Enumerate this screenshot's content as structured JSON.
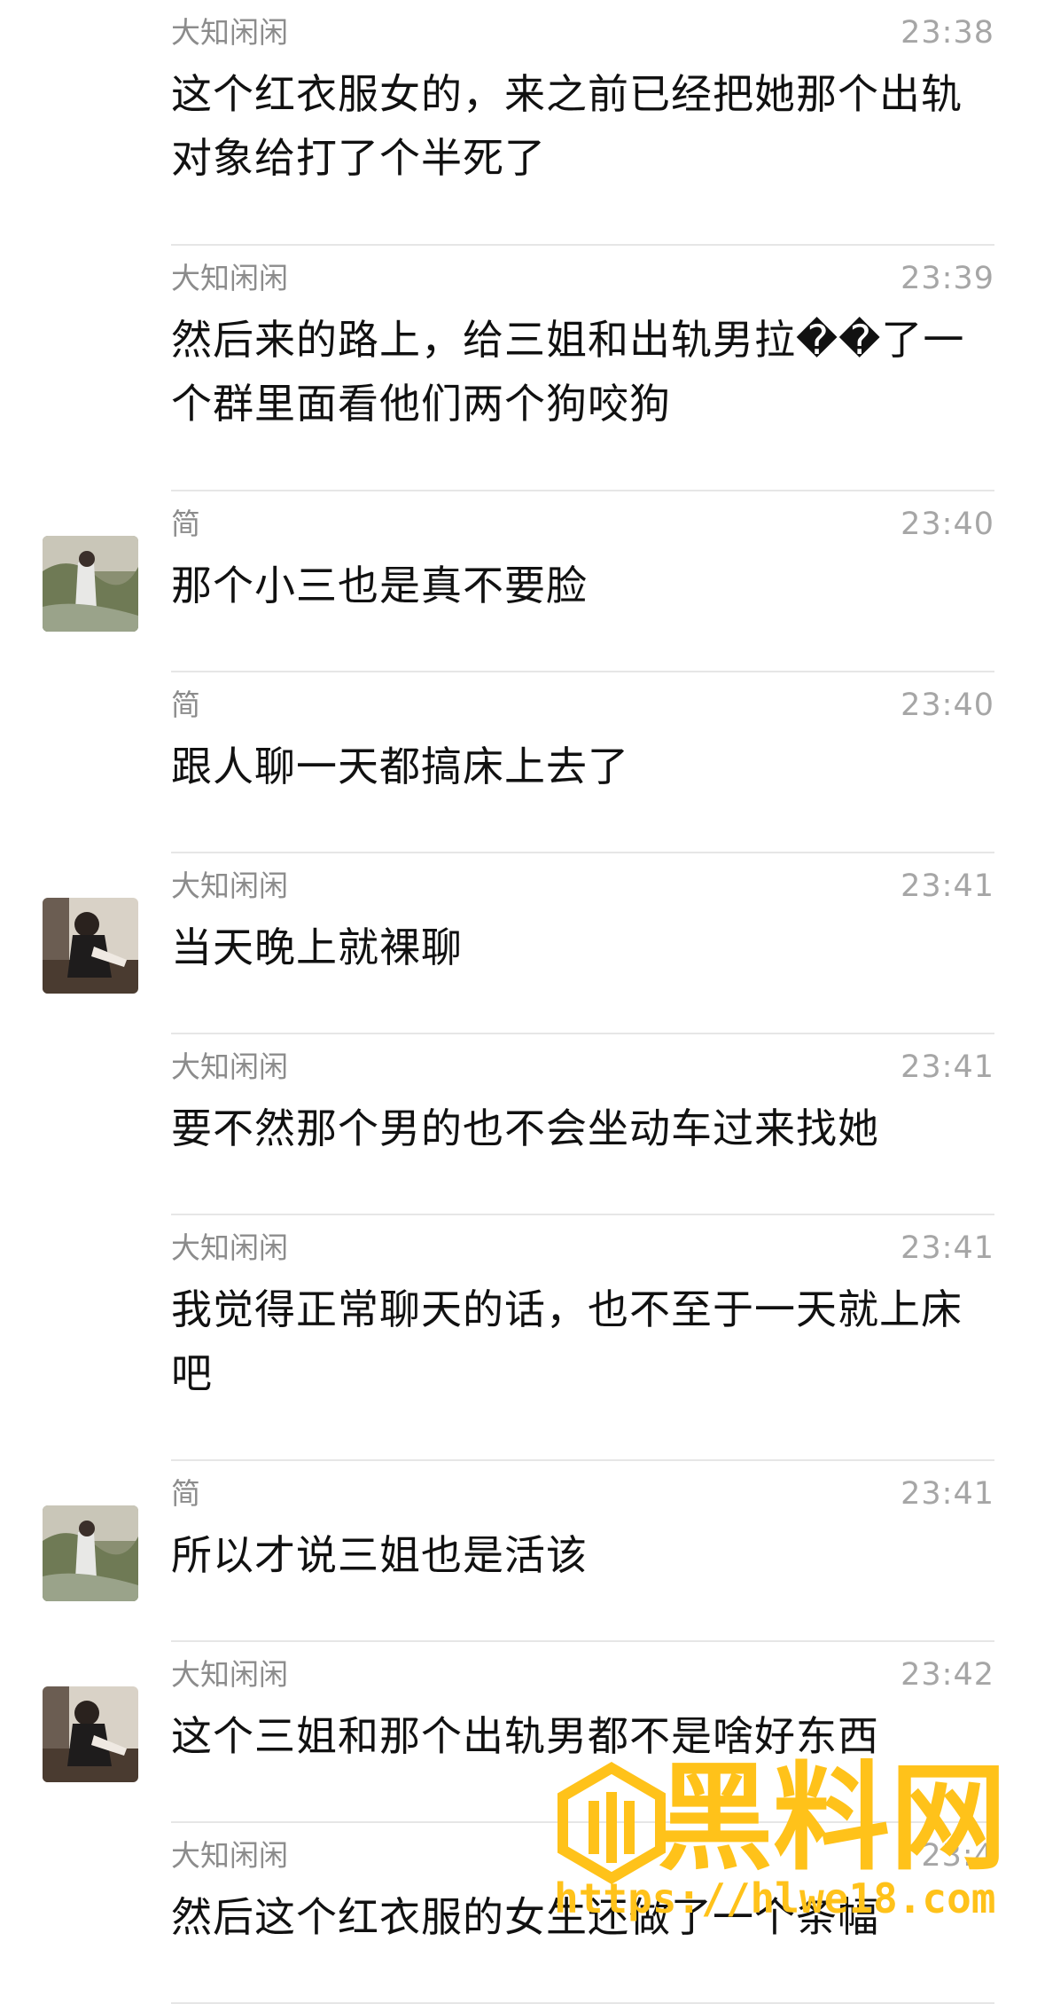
{
  "messages": [
    {
      "sender": "大知闲闲",
      "time": "23:38",
      "text": "这个红衣服女的，来之前已经把她那个出轨对象给打了个半死了",
      "avatar": null
    },
    {
      "sender": "大知闲闲",
      "time": "23:39",
      "text": "然后来的路上，给三姐和出轨男拉��了一个群里面看他们两个狗咬狗",
      "avatar": null
    },
    {
      "sender": "简",
      "time": "23:40",
      "text": "那个小三也是真不要脸",
      "avatar": "avatar-jian"
    },
    {
      "sender": "简",
      "time": "23:40",
      "text": "跟人聊一天都搞床上去了",
      "avatar": null
    },
    {
      "sender": "大知闲闲",
      "time": "23:41",
      "text": "当天晚上就裸聊",
      "avatar": "avatar-dazhi"
    },
    {
      "sender": "大知闲闲",
      "time": "23:41",
      "text": "要不然那个男的也不会坐动车过来找她",
      "avatar": null
    },
    {
      "sender": "大知闲闲",
      "time": "23:41",
      "text": "我觉得正常聊天的话，也不至于一天就上床吧",
      "avatar": null
    },
    {
      "sender": "简",
      "time": "23:41",
      "text": "所以才说三姐也是活该",
      "avatar": "avatar-jian"
    },
    {
      "sender": "大知闲闲",
      "time": "23:42",
      "text": "这个三姐和那个出轨男都不是啥好东西",
      "avatar": "avatar-dazhi"
    },
    {
      "sender": "大知闲闲",
      "time": "23:4",
      "text": "然后这个红衣服的女生还做了一个条幅",
      "avatar": null
    }
  ],
  "watermark": {
    "title": "黑料网",
    "url": "https://hlwe18.com",
    "color": "#ffc21a"
  }
}
